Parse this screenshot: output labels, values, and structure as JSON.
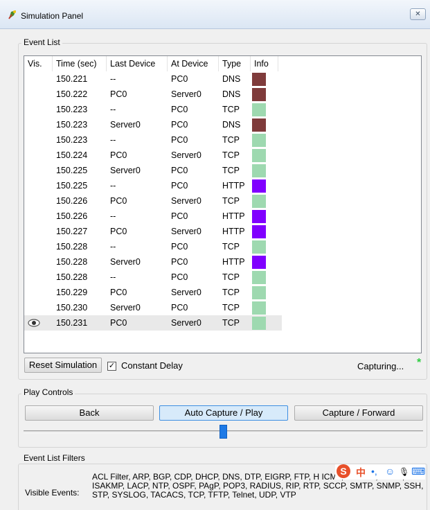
{
  "window": {
    "title": "Simulation Panel",
    "close_glyph": "✕"
  },
  "event_list": {
    "group_label": "Event List",
    "columns": [
      "Vis.",
      "Time (sec)",
      "Last Device",
      "At Device",
      "Type",
      "Info"
    ],
    "rows": [
      {
        "vis": "",
        "time": "150.221",
        "last": "--",
        "at": "PC0",
        "type": "DNS",
        "color": "#7f3b3b"
      },
      {
        "vis": "",
        "time": "150.222",
        "last": "PC0",
        "at": "Server0",
        "type": "DNS",
        "color": "#7f3b3b"
      },
      {
        "vis": "",
        "time": "150.223",
        "last": "--",
        "at": "PC0",
        "type": "TCP",
        "color": "#9ed9b0"
      },
      {
        "vis": "",
        "time": "150.223",
        "last": "Server0",
        "at": "PC0",
        "type": "DNS",
        "color": "#7f3b3b"
      },
      {
        "vis": "",
        "time": "150.223",
        "last": "--",
        "at": "PC0",
        "type": "TCP",
        "color": "#9ed9b0"
      },
      {
        "vis": "",
        "time": "150.224",
        "last": "PC0",
        "at": "Server0",
        "type": "TCP",
        "color": "#9ed9b0"
      },
      {
        "vis": "",
        "time": "150.225",
        "last": "Server0",
        "at": "PC0",
        "type": "TCP",
        "color": "#9ed9b0"
      },
      {
        "vis": "",
        "time": "150.225",
        "last": "--",
        "at": "PC0",
        "type": "HTTP",
        "color": "#8000ff"
      },
      {
        "vis": "",
        "time": "150.226",
        "last": "PC0",
        "at": "Server0",
        "type": "TCP",
        "color": "#9ed9b0"
      },
      {
        "vis": "",
        "time": "150.226",
        "last": "--",
        "at": "PC0",
        "type": "HTTP",
        "color": "#8000ff"
      },
      {
        "vis": "",
        "time": "150.227",
        "last": "PC0",
        "at": "Server0",
        "type": "HTTP",
        "color": "#8000ff"
      },
      {
        "vis": "",
        "time": "150.228",
        "last": "--",
        "at": "PC0",
        "type": "TCP",
        "color": "#9ed9b0"
      },
      {
        "vis": "",
        "time": "150.228",
        "last": "Server0",
        "at": "PC0",
        "type": "HTTP",
        "color": "#8000ff"
      },
      {
        "vis": "",
        "time": "150.228",
        "last": "--",
        "at": "PC0",
        "type": "TCP",
        "color": "#9ed9b0"
      },
      {
        "vis": "",
        "time": "150.229",
        "last": "PC0",
        "at": "Server0",
        "type": "TCP",
        "color": "#9ed9b0"
      },
      {
        "vis": "",
        "time": "150.230",
        "last": "Server0",
        "at": "PC0",
        "type": "TCP",
        "color": "#9ed9b0"
      },
      {
        "vis": "eye-icon",
        "time": "150.231",
        "last": "PC0",
        "at": "Server0",
        "type": "TCP",
        "color": "#9ed9b0",
        "selected": true
      }
    ],
    "reset_label": "Reset Simulation",
    "constant_delay_label": "Constant Delay",
    "constant_delay_checked": true,
    "check_glyph": "✓",
    "status": "Capturing...",
    "status_star": "*"
  },
  "play_controls": {
    "group_label": "Play Controls",
    "back_label": "Back",
    "auto_label": "Auto Capture / Play",
    "forward_label": "Capture / Forward",
    "speed_slider_level": 0.5
  },
  "filters": {
    "group_label": "Event List Filters",
    "visible_events_label": "Visible Events:",
    "visible_events": "ACL Filter, ARP, BGP, CDP, DHCP, DNS, DTP, EIGRP, FTP, H ICMP, ICMPv6, IPSec, ISAKMP, LACP, NTP, OSPF, PAgP, POP3, RADIUS, RIP, RTP, SCCP, SMTP, SNMP, SSH, STP, SYSLOG, TACACS, TCP, TFTP, Telnet, UDP, VTP"
  },
  "ime_toolbar": {
    "logo": "S",
    "lang": "中",
    "punct": "•,",
    "emoji": "☺",
    "mic": "🎙",
    "keyboard": "⌨"
  },
  "colors": {
    "dns": "#7f3b3b",
    "tcp": "#9ed9b0",
    "http": "#8000ff",
    "star": "#2ecc40",
    "accent": "#1e7ae6"
  }
}
